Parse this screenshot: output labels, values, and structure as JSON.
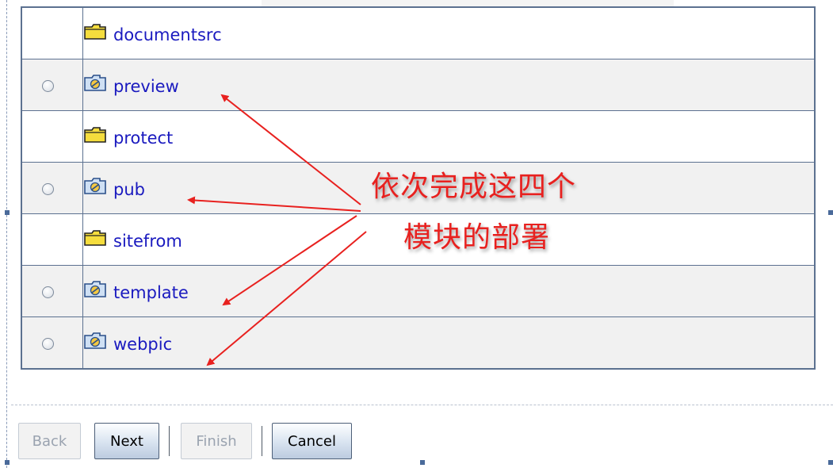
{
  "modules": [
    {
      "name": "documentsrc",
      "icon": "folder-icon",
      "has_radio": false
    },
    {
      "name": "preview",
      "icon": "web-module-icon",
      "has_radio": true
    },
    {
      "name": "protect",
      "icon": "folder-icon",
      "has_radio": false
    },
    {
      "name": "pub",
      "icon": "web-module-icon",
      "has_radio": true
    },
    {
      "name": "sitefrom",
      "icon": "folder-icon",
      "has_radio": false
    },
    {
      "name": "template",
      "icon": "web-module-icon",
      "has_radio": true
    },
    {
      "name": "webpic",
      "icon": "web-module-icon",
      "has_radio": true
    }
  ],
  "annotation": {
    "line1": "依次完成这四个",
    "line2": "模块的部署",
    "color": "#e8211f"
  },
  "buttons": {
    "back": "Back",
    "next": "Next",
    "finish": "Finish",
    "cancel": "Cancel"
  },
  "colors": {
    "link": "#1a1abf",
    "table_border": "#5c7190",
    "alt_row": "#f1f1f1"
  }
}
